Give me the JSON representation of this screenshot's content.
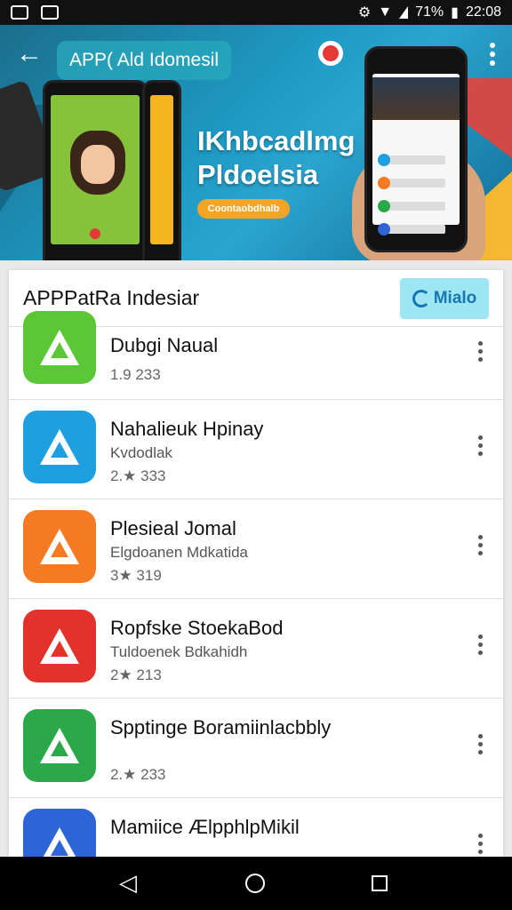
{
  "status_bar": {
    "battery_percent": "71%",
    "time": "22:08"
  },
  "app_bar": {
    "title": "APP( Ald Idomesil"
  },
  "hero": {
    "headline_line1": "IKhbcadlmg",
    "headline_line2": "Pldoelsia",
    "cta_label": "Coontaobdhalb"
  },
  "card": {
    "title": "APPPatRa Indesiar",
    "chip_label": "Mialo"
  },
  "apps": [
    {
      "name": "Dubgi Naual",
      "subtitle": "",
      "meta": "1.9 233",
      "color": "#5cc736"
    },
    {
      "name": "Nahalieuk Hpinay",
      "subtitle": "Kvdodlak",
      "meta": "2.★ 333",
      "color": "#1e9fe0"
    },
    {
      "name": "Plesieal Jomal",
      "subtitle": "Elgdoanen Mdkatida",
      "meta": "3★ 319",
      "color": "#f47a24"
    },
    {
      "name": "Ropfske StoekaBod",
      "subtitle": "Tuldoenek Bdkahidh",
      "meta": "2★ 213",
      "color": "#e3322b"
    },
    {
      "name": "Spptinge Boramiinlacbbly",
      "subtitle": "",
      "meta": "2.★ 233",
      "color": "#2aa84a"
    },
    {
      "name": "Mamiice ÆlpphlpMikil",
      "subtitle": "",
      "meta": "",
      "color": "#2d64d6"
    }
  ]
}
